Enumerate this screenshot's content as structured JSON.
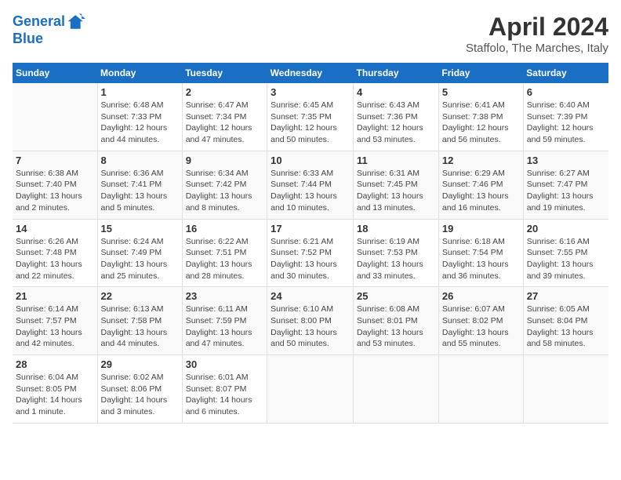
{
  "header": {
    "logo_line1": "General",
    "logo_line2": "Blue",
    "month_title": "April 2024",
    "location": "Staffolo, The Marches, Italy"
  },
  "weekdays": [
    "Sunday",
    "Monday",
    "Tuesday",
    "Wednesday",
    "Thursday",
    "Friday",
    "Saturday"
  ],
  "weeks": [
    [
      {
        "day": "",
        "info": ""
      },
      {
        "day": "1",
        "info": "Sunrise: 6:48 AM\nSunset: 7:33 PM\nDaylight: 12 hours\nand 44 minutes."
      },
      {
        "day": "2",
        "info": "Sunrise: 6:47 AM\nSunset: 7:34 PM\nDaylight: 12 hours\nand 47 minutes."
      },
      {
        "day": "3",
        "info": "Sunrise: 6:45 AM\nSunset: 7:35 PM\nDaylight: 12 hours\nand 50 minutes."
      },
      {
        "day": "4",
        "info": "Sunrise: 6:43 AM\nSunset: 7:36 PM\nDaylight: 12 hours\nand 53 minutes."
      },
      {
        "day": "5",
        "info": "Sunrise: 6:41 AM\nSunset: 7:38 PM\nDaylight: 12 hours\nand 56 minutes."
      },
      {
        "day": "6",
        "info": "Sunrise: 6:40 AM\nSunset: 7:39 PM\nDaylight: 12 hours\nand 59 minutes."
      }
    ],
    [
      {
        "day": "7",
        "info": "Sunrise: 6:38 AM\nSunset: 7:40 PM\nDaylight: 13 hours\nand 2 minutes."
      },
      {
        "day": "8",
        "info": "Sunrise: 6:36 AM\nSunset: 7:41 PM\nDaylight: 13 hours\nand 5 minutes."
      },
      {
        "day": "9",
        "info": "Sunrise: 6:34 AM\nSunset: 7:42 PM\nDaylight: 13 hours\nand 8 minutes."
      },
      {
        "day": "10",
        "info": "Sunrise: 6:33 AM\nSunset: 7:44 PM\nDaylight: 13 hours\nand 10 minutes."
      },
      {
        "day": "11",
        "info": "Sunrise: 6:31 AM\nSunset: 7:45 PM\nDaylight: 13 hours\nand 13 minutes."
      },
      {
        "day": "12",
        "info": "Sunrise: 6:29 AM\nSunset: 7:46 PM\nDaylight: 13 hours\nand 16 minutes."
      },
      {
        "day": "13",
        "info": "Sunrise: 6:27 AM\nSunset: 7:47 PM\nDaylight: 13 hours\nand 19 minutes."
      }
    ],
    [
      {
        "day": "14",
        "info": "Sunrise: 6:26 AM\nSunset: 7:48 PM\nDaylight: 13 hours\nand 22 minutes."
      },
      {
        "day": "15",
        "info": "Sunrise: 6:24 AM\nSunset: 7:49 PM\nDaylight: 13 hours\nand 25 minutes."
      },
      {
        "day": "16",
        "info": "Sunrise: 6:22 AM\nSunset: 7:51 PM\nDaylight: 13 hours\nand 28 minutes."
      },
      {
        "day": "17",
        "info": "Sunrise: 6:21 AM\nSunset: 7:52 PM\nDaylight: 13 hours\nand 30 minutes."
      },
      {
        "day": "18",
        "info": "Sunrise: 6:19 AM\nSunset: 7:53 PM\nDaylight: 13 hours\nand 33 minutes."
      },
      {
        "day": "19",
        "info": "Sunrise: 6:18 AM\nSunset: 7:54 PM\nDaylight: 13 hours\nand 36 minutes."
      },
      {
        "day": "20",
        "info": "Sunrise: 6:16 AM\nSunset: 7:55 PM\nDaylight: 13 hours\nand 39 minutes."
      }
    ],
    [
      {
        "day": "21",
        "info": "Sunrise: 6:14 AM\nSunset: 7:57 PM\nDaylight: 13 hours\nand 42 minutes."
      },
      {
        "day": "22",
        "info": "Sunrise: 6:13 AM\nSunset: 7:58 PM\nDaylight: 13 hours\nand 44 minutes."
      },
      {
        "day": "23",
        "info": "Sunrise: 6:11 AM\nSunset: 7:59 PM\nDaylight: 13 hours\nand 47 minutes."
      },
      {
        "day": "24",
        "info": "Sunrise: 6:10 AM\nSunset: 8:00 PM\nDaylight: 13 hours\nand 50 minutes."
      },
      {
        "day": "25",
        "info": "Sunrise: 6:08 AM\nSunset: 8:01 PM\nDaylight: 13 hours\nand 53 minutes."
      },
      {
        "day": "26",
        "info": "Sunrise: 6:07 AM\nSunset: 8:02 PM\nDaylight: 13 hours\nand 55 minutes."
      },
      {
        "day": "27",
        "info": "Sunrise: 6:05 AM\nSunset: 8:04 PM\nDaylight: 13 hours\nand 58 minutes."
      }
    ],
    [
      {
        "day": "28",
        "info": "Sunrise: 6:04 AM\nSunset: 8:05 PM\nDaylight: 14 hours\nand 1 minute."
      },
      {
        "day": "29",
        "info": "Sunrise: 6:02 AM\nSunset: 8:06 PM\nDaylight: 14 hours\nand 3 minutes."
      },
      {
        "day": "30",
        "info": "Sunrise: 6:01 AM\nSunset: 8:07 PM\nDaylight: 14 hours\nand 6 minutes."
      },
      {
        "day": "",
        "info": ""
      },
      {
        "day": "",
        "info": ""
      },
      {
        "day": "",
        "info": ""
      },
      {
        "day": "",
        "info": ""
      }
    ]
  ]
}
